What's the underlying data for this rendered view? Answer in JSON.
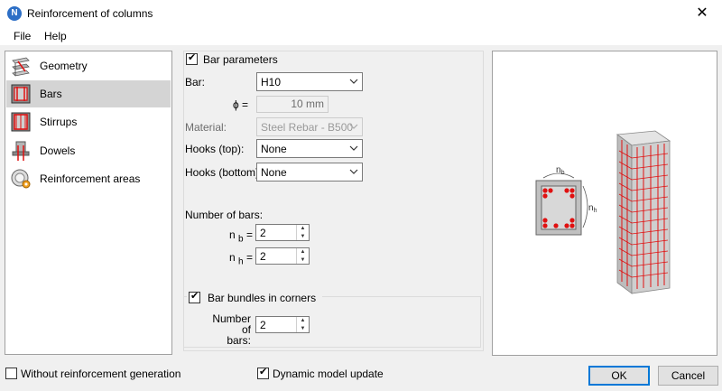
{
  "window": {
    "title": "Reinforcement of columns",
    "app_icon_letter": "N"
  },
  "menu": {
    "items": [
      "File",
      "Help"
    ]
  },
  "sidebar": {
    "items": [
      {
        "label": "Geometry",
        "icon": "geometry-icon"
      },
      {
        "label": "Bars",
        "icon": "bars-icon",
        "selected": true
      },
      {
        "label": "Stirrups",
        "icon": "stirrups-icon"
      },
      {
        "label": "Dowels",
        "icon": "dowels-icon"
      },
      {
        "label": "Reinforcement areas",
        "icon": "reinforcement-areas-icon"
      }
    ]
  },
  "bar_params": {
    "checkbox_label": "Bar parameters",
    "checked": true,
    "bar_label": "Bar:",
    "bar_value": "H10",
    "phi_label": "ϕ =",
    "phi_value": "10 mm",
    "material_label": "Material:",
    "material_value": "Steel Rebar - B500",
    "hooks_top_label": "Hooks (top):",
    "hooks_top_value": "None",
    "hooks_bottom_label": "Hooks (bottom):",
    "hooks_bottom_value": "None",
    "number_of_bars_label": "Number of bars:",
    "nb_label": "n",
    "nb_sub": "b",
    "nb_eq": "=",
    "nb_value": "2",
    "nh_label": "n",
    "nh_sub": "h",
    "nh_eq": "=",
    "nh_value": "2"
  },
  "bundles": {
    "checkbox_label": "Bar bundles in corners",
    "checked": true,
    "num_label_line1": "Number of",
    "num_label_line2": "bars:",
    "num_value": "2"
  },
  "preview": {
    "nb_label": "n",
    "nb_sub": "b",
    "nh_label": "n",
    "nh_sub": "h"
  },
  "footer": {
    "without_reinforcement_label": "Without reinforcement generation",
    "without_reinforcement_checked": false,
    "dynamic_update_label": "Dynamic model update",
    "dynamic_update_checked": true,
    "ok_label": "OK",
    "cancel_label": "Cancel"
  },
  "colors": {
    "accent": "#0078d7",
    "rebar": "#e01010",
    "selected_bg": "#d4d4d4"
  }
}
